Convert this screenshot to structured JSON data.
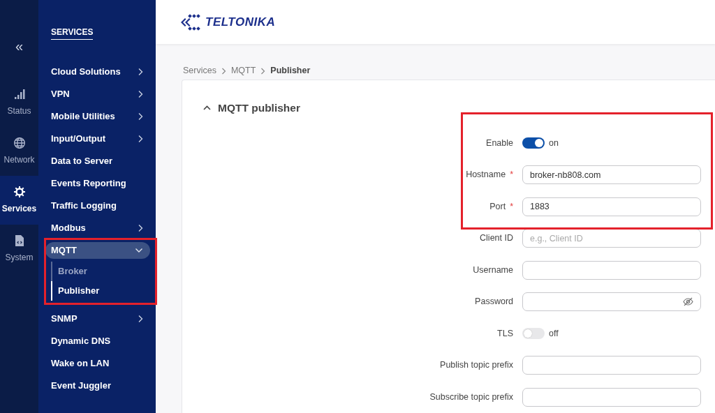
{
  "rail": {
    "collapse": "«",
    "items": [
      {
        "label": "Status",
        "selected": false
      },
      {
        "label": "Network",
        "selected": false
      },
      {
        "label": "Services",
        "selected": true
      },
      {
        "label": "System",
        "selected": false
      }
    ]
  },
  "sidebar": {
    "title": "SERVICES",
    "items": [
      {
        "label": "Cloud Solutions",
        "has_submenu": true
      },
      {
        "label": "VPN",
        "has_submenu": true
      },
      {
        "label": "Mobile Utilities",
        "has_submenu": true
      },
      {
        "label": "Input/Output",
        "has_submenu": true
      },
      {
        "label": "Data to Server",
        "has_submenu": false
      },
      {
        "label": "Events Reporting",
        "has_submenu": false
      },
      {
        "label": "Traffic Logging",
        "has_submenu": false
      },
      {
        "label": "Modbus",
        "has_submenu": true
      },
      {
        "label": "MQTT",
        "has_submenu": true,
        "expanded": true,
        "highlighted": true,
        "children": [
          {
            "label": "Broker",
            "selected": false
          },
          {
            "label": "Publisher",
            "selected": true
          }
        ]
      },
      {
        "label": "SNMP",
        "has_submenu": true
      },
      {
        "label": "Dynamic DNS",
        "has_submenu": false
      },
      {
        "label": "Wake on LAN",
        "has_submenu": false
      },
      {
        "label": "Event Juggler",
        "has_submenu": false
      }
    ]
  },
  "header": {
    "logo": "TELTONIKA"
  },
  "breadcrumb": [
    "Services",
    "MQTT",
    "Publisher"
  ],
  "section": {
    "title": "MQTT publisher",
    "expanded": true,
    "fields": [
      {
        "kind": "toggle",
        "label": "Enable",
        "on": true,
        "state_text": "on",
        "highlighted": true
      },
      {
        "kind": "text",
        "label": "Hostname",
        "required_mark": "*",
        "value": "broker-nb808.com",
        "highlighted": true
      },
      {
        "kind": "text",
        "label": "Port",
        "required_mark": "*",
        "value": "1883",
        "highlighted": true
      },
      {
        "kind": "text",
        "label": "Client ID",
        "placeholder": "e.g., Client ID",
        "highlighted": false
      },
      {
        "kind": "text",
        "label": "Username",
        "highlighted": false
      },
      {
        "kind": "password",
        "label": "Password",
        "highlighted": false
      },
      {
        "kind": "toggle",
        "label": "TLS",
        "on": false,
        "state_text": "off",
        "highlighted": false
      },
      {
        "kind": "text",
        "label": "Publish topic prefix",
        "highlighted": false
      },
      {
        "kind": "text",
        "label": "Subscribe topic prefix",
        "highlighted": false
      }
    ]
  }
}
